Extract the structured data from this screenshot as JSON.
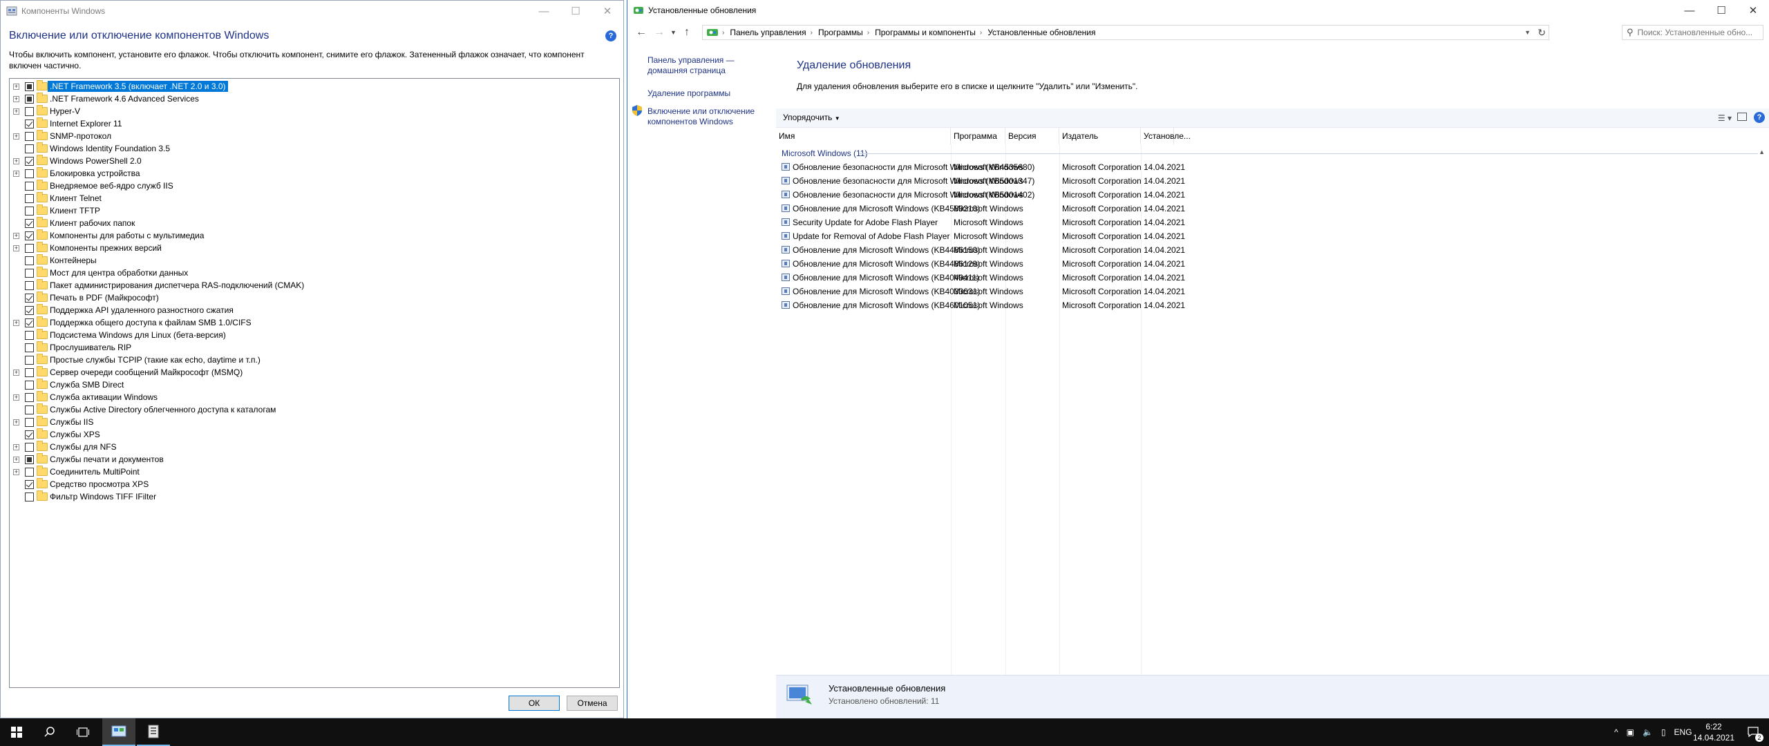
{
  "left_window": {
    "title": "Компоненты Windows",
    "heading": "Включение или отключение компонентов Windows",
    "description": "Чтобы включить компонент, установите его флажок. Чтобы отключить компонент, снимите его флажок. Затененный флажок означает, что компонент включен частично.",
    "features": [
      {
        "label": ".NET Framework 3.5 (включает .NET 2.0 и 3.0)",
        "state": "partial",
        "expandable": true,
        "selected": true
      },
      {
        "label": ".NET Framework 4.6 Advanced Services",
        "state": "partial",
        "expandable": true
      },
      {
        "label": "Hyper-V",
        "state": "unchecked",
        "expandable": true
      },
      {
        "label": "Internet Explorer 11",
        "state": "checked",
        "expandable": false
      },
      {
        "label": "SNMP-протокол",
        "state": "unchecked",
        "expandable": true
      },
      {
        "label": "Windows Identity Foundation 3.5",
        "state": "unchecked",
        "expandable": false
      },
      {
        "label": "Windows PowerShell 2.0",
        "state": "checked",
        "expandable": true
      },
      {
        "label": "Блокировка устройства",
        "state": "unchecked",
        "expandable": true
      },
      {
        "label": "Внедряемое веб-ядро служб IIS",
        "state": "unchecked",
        "expandable": false
      },
      {
        "label": "Клиент Telnet",
        "state": "unchecked",
        "expandable": false
      },
      {
        "label": "Клиент TFTP",
        "state": "unchecked",
        "expandable": false
      },
      {
        "label": "Клиент рабочих папок",
        "state": "checked",
        "expandable": false
      },
      {
        "label": "Компоненты для работы с мультимедиа",
        "state": "checked",
        "expandable": true
      },
      {
        "label": "Компоненты прежних версий",
        "state": "unchecked",
        "expandable": true
      },
      {
        "label": "Контейнеры",
        "state": "unchecked",
        "expandable": false
      },
      {
        "label": "Мост для центра обработки данных",
        "state": "unchecked",
        "expandable": false
      },
      {
        "label": "Пакет администрирования диспетчера RAS-подключений (CMAK)",
        "state": "unchecked",
        "expandable": false
      },
      {
        "label": "Печать в PDF (Майкрософт)",
        "state": "checked",
        "expandable": false
      },
      {
        "label": "Поддержка API удаленного разностного сжатия",
        "state": "checked",
        "expandable": false
      },
      {
        "label": "Поддержка общего доступа к файлам SMB 1.0/CIFS",
        "state": "checked",
        "expandable": true
      },
      {
        "label": "Подсистема Windows для Linux (бета-версия)",
        "state": "unchecked",
        "expandable": false
      },
      {
        "label": "Прослушиватель RIP",
        "state": "unchecked",
        "expandable": false
      },
      {
        "label": "Простые службы TCPIP (такие как echo, daytime и т.п.)",
        "state": "unchecked",
        "expandable": false
      },
      {
        "label": "Сервер очереди сообщений Майкрософт (MSMQ)",
        "state": "unchecked",
        "expandable": true
      },
      {
        "label": "Служба SMB Direct",
        "state": "unchecked",
        "expandable": false
      },
      {
        "label": "Служба активации Windows",
        "state": "unchecked",
        "expandable": true
      },
      {
        "label": "Службы Active Directory облегченного доступа к каталогам",
        "state": "unchecked",
        "expandable": false
      },
      {
        "label": "Службы IIS",
        "state": "unchecked",
        "expandable": true
      },
      {
        "label": "Службы XPS",
        "state": "checked",
        "expandable": false
      },
      {
        "label": "Службы для NFS",
        "state": "unchecked",
        "expandable": true
      },
      {
        "label": "Службы печати и документов",
        "state": "partial",
        "expandable": true
      },
      {
        "label": "Соединитель MultiPoint",
        "state": "unchecked",
        "expandable": true
      },
      {
        "label": "Средство просмотра XPS",
        "state": "checked",
        "expandable": false
      },
      {
        "label": "Фильтр Windows TIFF IFilter",
        "state": "unchecked",
        "expandable": false
      }
    ],
    "ok_label": "ОК",
    "cancel_label": "Отмена"
  },
  "right_window": {
    "title": "Установленные обновления",
    "breadcrumbs": [
      "Панель управления",
      "Программы",
      "Программы и компоненты",
      "Установленные обновления"
    ],
    "search_placeholder": "Поиск: Установленные обно...",
    "side_links": [
      "Панель управления — домашняя страница",
      "Удаление программы",
      "Включение или отключение компонентов Windows"
    ],
    "heading": "Удаление обновления",
    "description": "Для удаления обновления выберите его в списке и щелкните \"Удалить\" или \"Изменить\".",
    "sort_label": "Упорядочить",
    "columns": [
      "Имя",
      "Программа",
      "Версия",
      "Издатель",
      "Установле..."
    ],
    "group_label": "Microsoft Windows (11)",
    "updates": [
      {
        "name": "Обновление безопасности для Microsoft Windows (KB4535680)",
        "program": "Microsoft Windows",
        "version": "",
        "publisher": "Microsoft Corporation",
        "installed": "14.04.2021"
      },
      {
        "name": "Обновление безопасности для Microsoft Windows (KB5001347)",
        "program": "Microsoft Windows",
        "version": "",
        "publisher": "Microsoft Corporation",
        "installed": "14.04.2021"
      },
      {
        "name": "Обновление безопасности для Microsoft Windows (KB5001402)",
        "program": "Microsoft Windows",
        "version": "",
        "publisher": "Microsoft Corporation",
        "installed": "14.04.2021"
      },
      {
        "name": "Обновление для Microsoft Windows (KB4589210)",
        "program": "Microsoft Windows",
        "version": "",
        "publisher": "Microsoft Corporation",
        "installed": "14.04.2021"
      },
      {
        "name": "Security Update for Adobe Flash Player",
        "program": "Microsoft Windows",
        "version": "",
        "publisher": "Microsoft Corporation",
        "installed": "14.04.2021"
      },
      {
        "name": "Update for Removal of Adobe Flash Player",
        "program": "Microsoft Windows",
        "version": "",
        "publisher": "Microsoft Corporation",
        "installed": "14.04.2021"
      },
      {
        "name": "Обновление для Microsoft Windows (KB4486150)",
        "program": "Microsoft Windows",
        "version": "",
        "publisher": "Microsoft Corporation",
        "installed": "14.04.2021"
      },
      {
        "name": "Обновление для Microsoft Windows (KB4486129)",
        "program": "Microsoft Windows",
        "version": "",
        "publisher": "Microsoft Corporation",
        "installed": "14.04.2021"
      },
      {
        "name": "Обновление для Microsoft Windows (KB4049411)",
        "program": "Microsoft Windows",
        "version": "",
        "publisher": "Microsoft Corporation",
        "installed": "14.04.2021"
      },
      {
        "name": "Обновление для Microsoft Windows (KB4033631)",
        "program": "Microsoft Windows",
        "version": "",
        "publisher": "Microsoft Corporation",
        "installed": "14.04.2021"
      },
      {
        "name": "Обновление для Microsoft Windows (KB4601051)",
        "program": "Microsoft Windows",
        "version": "",
        "publisher": "Microsoft Corporation",
        "installed": "14.04.2021"
      }
    ],
    "details_title": "Установленные обновления",
    "details_subtitle": "Установлено обновлений: 11"
  },
  "taskbar": {
    "language": "ENG",
    "time": "6:22",
    "date": "14.04.2021",
    "notification_count": "2"
  },
  "colors": {
    "link_blue": "#1e3287",
    "selection": "#0078d7",
    "taskbar": "#101010"
  }
}
